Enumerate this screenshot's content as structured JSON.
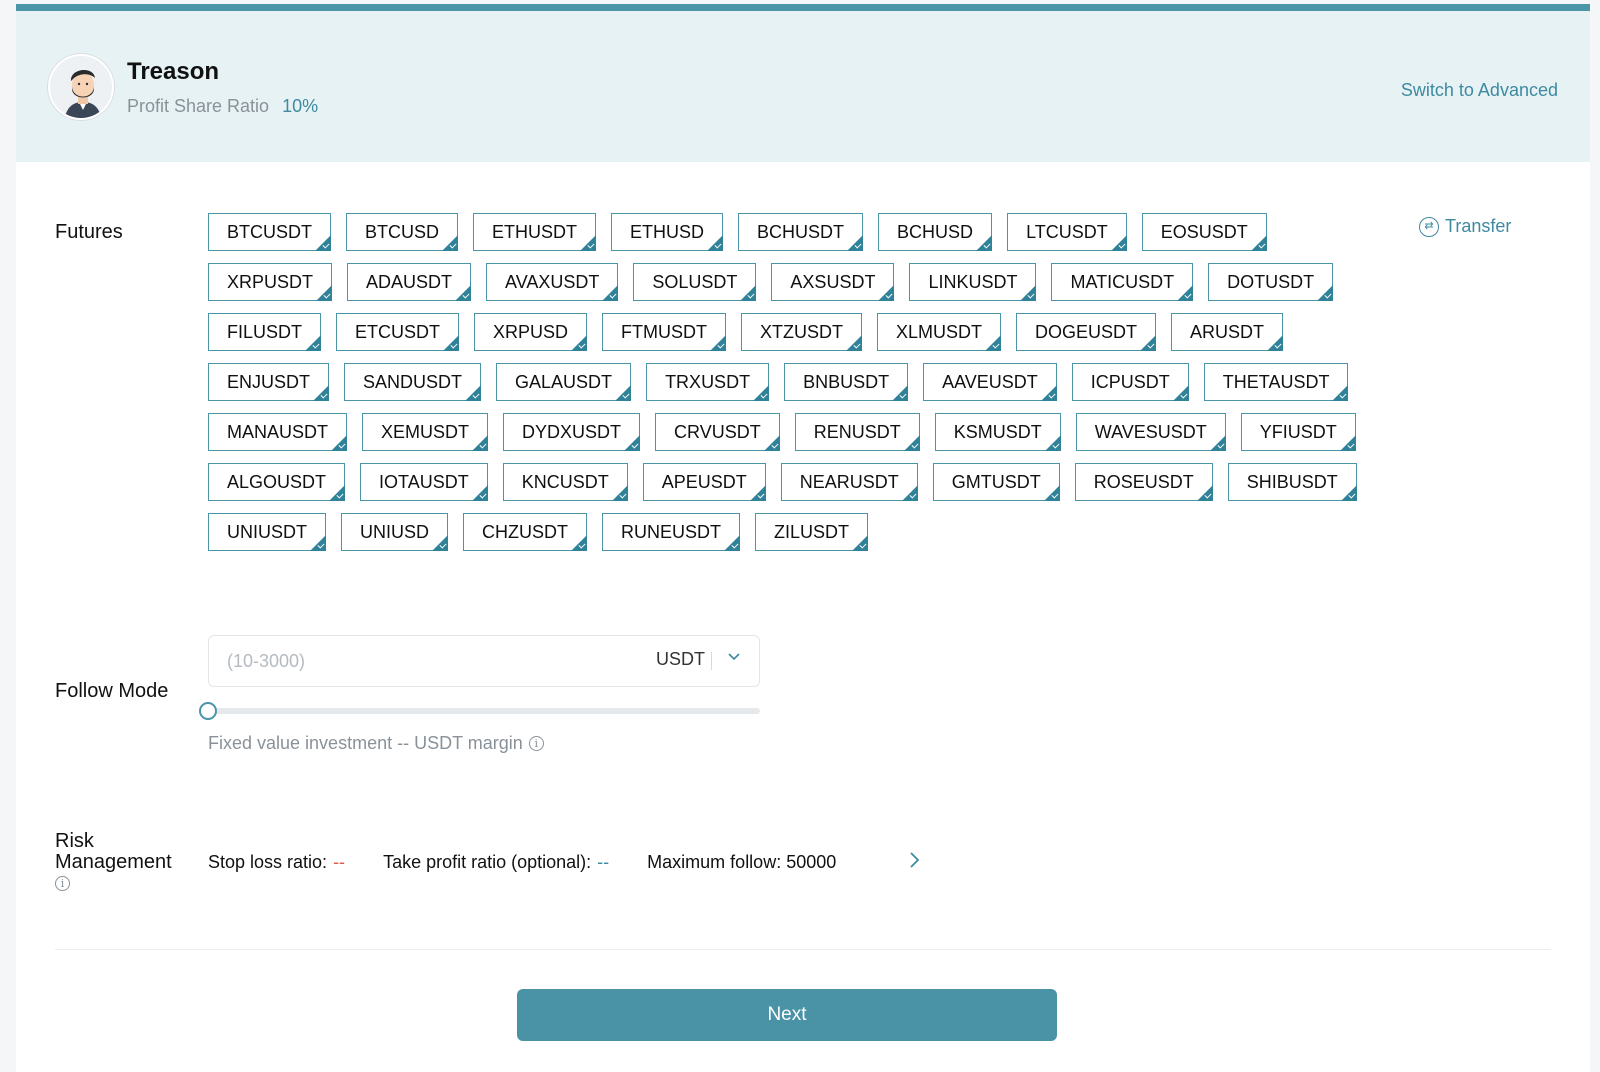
{
  "colors": {
    "accent": "#4a95a8",
    "header_bg": "#e6f2f3",
    "danger": "#e05a4a"
  },
  "trader": {
    "name": "Treason",
    "profit_share_label": "Profit Share Ratio",
    "profit_share_value": "10%",
    "switch_label": "Switch to Advanced"
  },
  "futures": {
    "label": "Futures",
    "transfer_label": "Transfer",
    "rows": [
      [
        "BTCUSDT",
        "BTCUSD",
        "ETHUSDT",
        "ETHUSD",
        "BCHUSDT",
        "BCHUSD",
        "LTCUSDT",
        "EOSUSDT"
      ],
      [
        "XRPUSDT",
        "ADAUSDT",
        "AVAXUSDT",
        "SOLUSDT",
        "AXSUSDT",
        "LINKUSDT",
        "MATICUSDT",
        "DOTUSDT"
      ],
      [
        "FILUSDT",
        "ETCUSDT",
        "XRPUSD",
        "FTMUSDT",
        "XTZUSDT",
        "XLMUSDT",
        "DOGEUSDT",
        "ARUSDT"
      ],
      [
        "ENJUSDT",
        "SANDUSDT",
        "GALAUSDT",
        "TRXUSDT",
        "BNBUSDT",
        "AAVEUSDT",
        "ICPUSDT",
        "THETAUSDT"
      ],
      [
        "MANAUSDT",
        "XEMUSDT",
        "DYDXUSDT",
        "CRVUSDT",
        "RENUSDT",
        "KSMUSDT",
        "WAVESUSDT",
        "YFIUSDT"
      ],
      [
        "ALGOUSDT",
        "IOTAUSDT",
        "KNCUSDT",
        "APEUSDT",
        "NEARUSDT",
        "GMTUSDT",
        "ROSEUSDT",
        "SHIBUSDT"
      ],
      [
        "UNIUSDT",
        "UNIUSD",
        "CHZUSDT",
        "RUNEUSDT",
        "ZILUSDT"
      ]
    ]
  },
  "follow_mode": {
    "label": "Follow Mode",
    "amount_placeholder": "(10-3000)",
    "amount_value": "",
    "unit": "USDT",
    "slider_fraction": 0,
    "hint": "Fixed value investment -- USDT margin"
  },
  "risk": {
    "label": "Risk Management",
    "stop_loss_label": "Stop loss ratio:",
    "stop_loss_value": "--",
    "take_profit_label": "Take profit ratio (optional):",
    "take_profit_value": "--",
    "max_follow_label": "Maximum follow: 50000"
  },
  "next_label": "Next",
  "icons": {
    "transfer": "transfer-icon",
    "info": "info-icon",
    "dropdown": "chevron-down-icon",
    "arrow": "chevron-right-icon",
    "check": "check-corner-icon"
  }
}
